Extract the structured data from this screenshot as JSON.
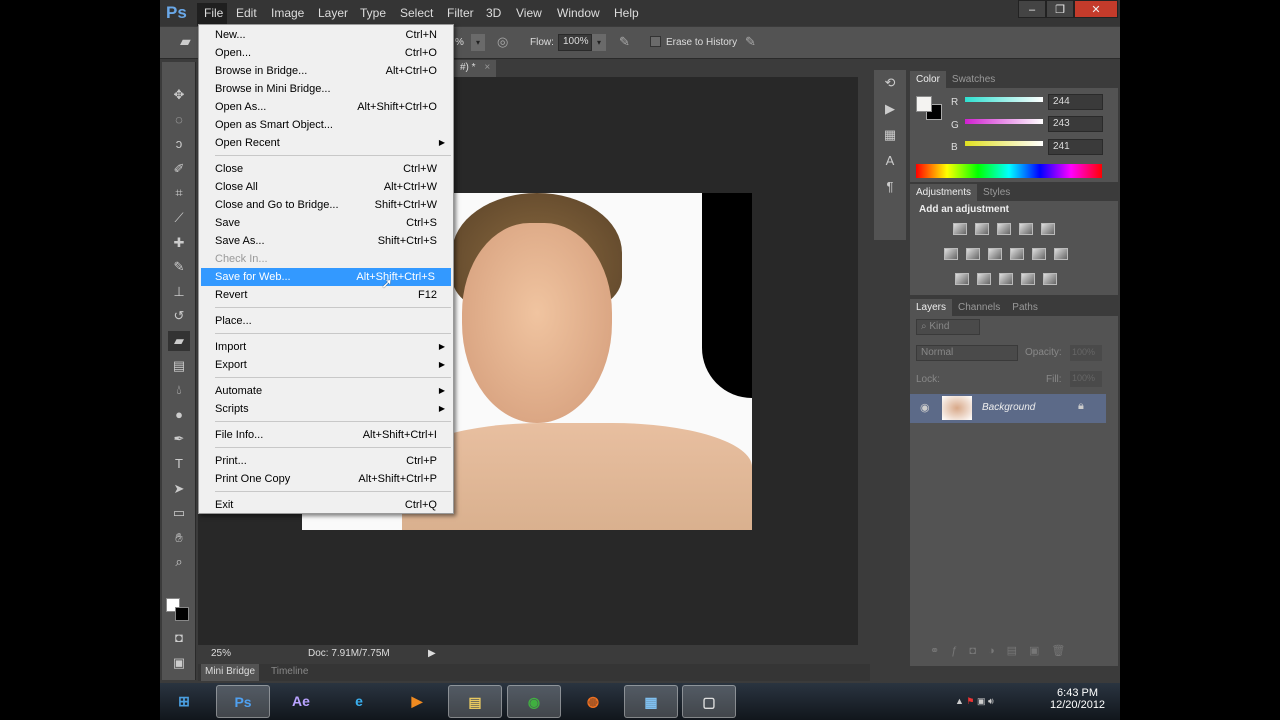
{
  "app": {
    "logo": "Ps"
  },
  "menubar": {
    "items": [
      "File",
      "Edit",
      "Image",
      "Layer",
      "Type",
      "Select",
      "Filter",
      "3D",
      "View",
      "Window",
      "Help"
    ],
    "active": "File"
  },
  "window_controls": {
    "minimize": "–",
    "restore": "❐",
    "close": "✕"
  },
  "options": {
    "opacity_partial": "%",
    "flow_label": "Flow:",
    "flow_value": "100%",
    "erase_to_history": "Erase to History",
    "erase_checked": false
  },
  "document": {
    "tab_label": "#) *",
    "tab_close": "×"
  },
  "status": {
    "zoom": "25%",
    "doc": "Doc: 7.91M/7.75M"
  },
  "bottom_tabs": [
    "Mini Bridge",
    "Timeline"
  ],
  "file_menu": [
    {
      "label": "New...",
      "shortcut": "Ctrl+N"
    },
    {
      "label": "Open...",
      "shortcut": "Ctrl+O"
    },
    {
      "label": "Browse in Bridge...",
      "shortcut": "Alt+Ctrl+O"
    },
    {
      "label": "Browse in Mini Bridge...",
      "shortcut": ""
    },
    {
      "label": "Open As...",
      "shortcut": "Alt+Shift+Ctrl+O"
    },
    {
      "label": "Open as Smart Object...",
      "shortcut": ""
    },
    {
      "label": "Open Recent",
      "shortcut": "",
      "submenu": true,
      "sep_after": true
    },
    {
      "label": "Close",
      "shortcut": "Ctrl+W"
    },
    {
      "label": "Close All",
      "shortcut": "Alt+Ctrl+W"
    },
    {
      "label": "Close and Go to Bridge...",
      "shortcut": "Shift+Ctrl+W"
    },
    {
      "label": "Save",
      "shortcut": "Ctrl+S"
    },
    {
      "label": "Save As...",
      "shortcut": "Shift+Ctrl+S"
    },
    {
      "label": "Check In...",
      "shortcut": "",
      "disabled": true
    },
    {
      "label": "Save for Web...",
      "shortcut": "Alt+Shift+Ctrl+S",
      "highlighted": true
    },
    {
      "label": "Revert",
      "shortcut": "F12",
      "sep_after": true
    },
    {
      "label": "Place...",
      "shortcut": "",
      "sep_after": true
    },
    {
      "label": "Import",
      "shortcut": "",
      "submenu": true
    },
    {
      "label": "Export",
      "shortcut": "",
      "submenu": true,
      "sep_after": true
    },
    {
      "label": "Automate",
      "shortcut": "",
      "submenu": true
    },
    {
      "label": "Scripts",
      "shortcut": "",
      "submenu": true,
      "sep_after": true
    },
    {
      "label": "File Info...",
      "shortcut": "Alt+Shift+Ctrl+I",
      "sep_after": true
    },
    {
      "label": "Print...",
      "shortcut": "Ctrl+P"
    },
    {
      "label": "Print One Copy",
      "shortcut": "Alt+Shift+Ctrl+P",
      "sep_after": true
    },
    {
      "label": "Exit",
      "shortcut": "Ctrl+Q"
    }
  ],
  "color_panel": {
    "tabs": [
      "Color",
      "Swatches"
    ],
    "r_label": "R",
    "g_label": "G",
    "b_label": "B",
    "r": "244",
    "g": "243",
    "b": "241"
  },
  "adjustments_panel": {
    "tabs": [
      "Adjustments",
      "Styles"
    ],
    "heading": "Add an adjustment"
  },
  "layers_panel": {
    "tabs": [
      "Layers",
      "Channels",
      "Paths"
    ],
    "filter": "Kind",
    "blend_mode": "Normal",
    "opacity_label": "Opacity:",
    "opacity": "100%",
    "lock_label": "Lock:",
    "fill_label": "Fill:",
    "fill": "100%",
    "layers": [
      {
        "name": "Background",
        "visible": true,
        "locked": true
      }
    ]
  },
  "taskbar": {
    "apps": [
      "Windows Start",
      "Photoshop",
      "After Effects",
      "Internet Explorer",
      "Media Player",
      "Windows Explorer",
      "Chrome",
      "Firefox",
      "Control Panel",
      "Snipping Tool"
    ],
    "time": "6:43 PM",
    "date": "12/20/2012"
  },
  "colors": {
    "accent": "#3399ff",
    "panel": "#535353",
    "canvas": "#282828"
  }
}
